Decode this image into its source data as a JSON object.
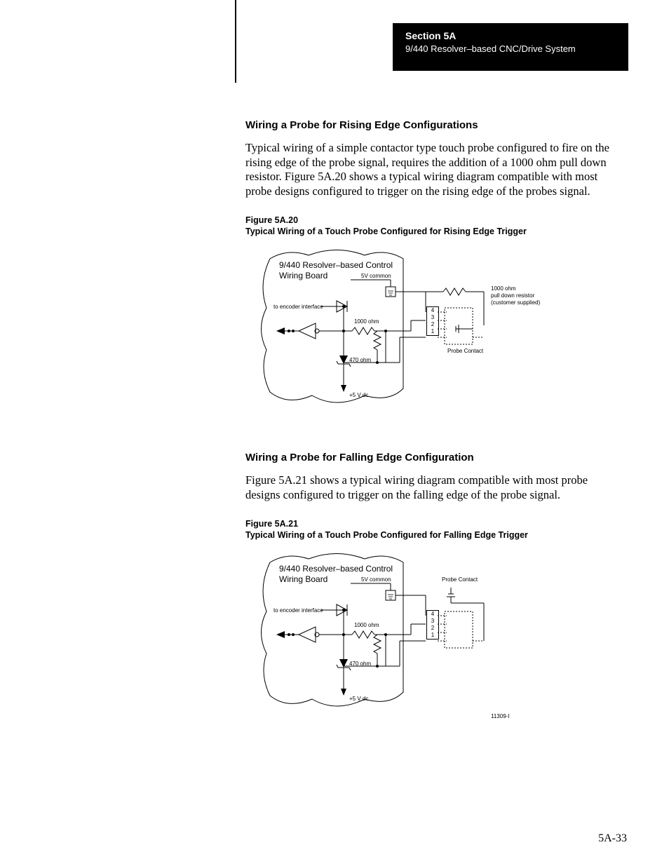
{
  "header": {
    "section": "Section 5A",
    "subtitle": "9/440 Resolver–based CNC/Drive System"
  },
  "section1": {
    "heading": "Wiring a Probe for Rising Edge Configurations",
    "paragraph": "Typical wiring of a simple contactor type touch probe configured to fire on the rising edge of the probe signal, requires the addition of a 1000 ohm pull down resistor.  Figure 5A.20 shows a typical wiring diagram compatible with most probe designs configured to trigger on the rising edge of the probes signal.",
    "fig_num": "Figure 5A.20",
    "fig_caption": "Typical Wiring of a Touch Probe Configured for Rising Edge Trigger"
  },
  "section2": {
    "heading": "Wiring a Probe for Falling Edge Configuration",
    "paragraph": "Figure 5A.21 shows a typical wiring diagram compatible with most probe designs configured to trigger on the falling edge of the probe signal.",
    "fig_num": "Figure 5A.21",
    "fig_caption": "Typical Wiring of a Touch Probe Configured for Falling Edge Trigger"
  },
  "diagram1": {
    "board_line1": "9/440 Resolver–based Control",
    "board_line2": "Wiring Board",
    "common": "5V common",
    "encoder": "to encoder interface",
    "r1000_int": "1000 ohm",
    "r470": "470 ohm",
    "vdc": "+5 V dc",
    "pulldown_l1": "1000 ohm",
    "pulldown_l2": "pull down resistor",
    "pulldown_l3": "(customer supplied)",
    "probe": "Probe Contact",
    "pins": {
      "p1": "1",
      "p2": "2",
      "p3": "3",
      "p4": "4"
    }
  },
  "diagram2": {
    "board_line1": "9/440 Resolver–based Control",
    "board_line2": "Wiring Board",
    "common": "5V common",
    "encoder": "to encoder interface",
    "r1000_int": "1000 ohm",
    "r470": "470 ohm",
    "vdc": "+5 V dc",
    "probe": "Probe Contact",
    "pins": {
      "p1": "1",
      "p2": "2",
      "p3": "3",
      "p4": "4"
    },
    "drawing_id": "11309-I"
  },
  "page_number": "5A-33"
}
